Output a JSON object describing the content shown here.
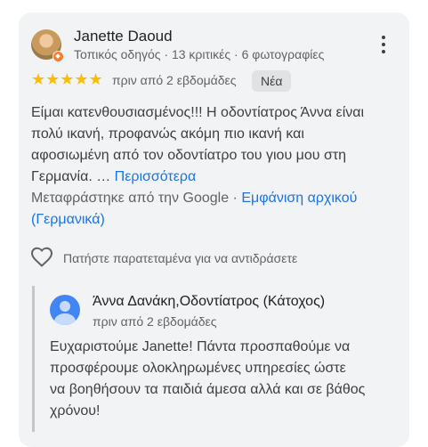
{
  "review": {
    "reviewer_name": "Janette Daoud",
    "reviewer_meta": "Τοπικός οδηγός · 13 κριτικές · 6 φωτογραφίες",
    "stars": "★★★★★",
    "rating": 5,
    "date": "πριν από 2 εβδομάδες",
    "badge": "Νέα",
    "body_lines": [
      "Είμαι κατενθουσιασμένος!!! Η οδοντίατρος Άννα είναι",
      "πολύ ικανή, προφανώς ακόμη πιο ικανή και",
      "αφοσιωμένη από τον οδοντίατρο του γιου μου στη",
      "Γερμανία. … "
    ],
    "more_link": "Περισσότερα",
    "translated_prefix": "Μεταφράστηκε από την Google · ",
    "show_original_line1": "Εμφάνιση αρχικού",
    "show_original_line2": "(Γερμανικά)",
    "react_hint": "Πατήστε παρατεταμένα για να αντιδράσετε"
  },
  "owner_reply": {
    "name": "Άννα Δανάκη,Οδοντίατρος (Κάτοχος)",
    "date": "πριν από 2 εβδομάδες",
    "body_lines": [
      "Ευχαριστούμε Janette! Πάντα προσπαθούμε να",
      "προσφέρουμε ολοκληρωμένες υπηρεσίες ώστε",
      "να βοηθήσουν τα παιδιά άμεσα αλλά και σε βάθος",
      "χρόνου!"
    ]
  },
  "colors": {
    "star": "#fbbc04",
    "link": "#1a73e8",
    "card_bg": "#f1f3f4",
    "owner_avatar": "#4285f4"
  },
  "icons": {
    "menu": "more-vert-icon",
    "react": "heart-outline-icon",
    "badge": "local-guide-badge-icon",
    "owner_avatar": "person-icon"
  }
}
